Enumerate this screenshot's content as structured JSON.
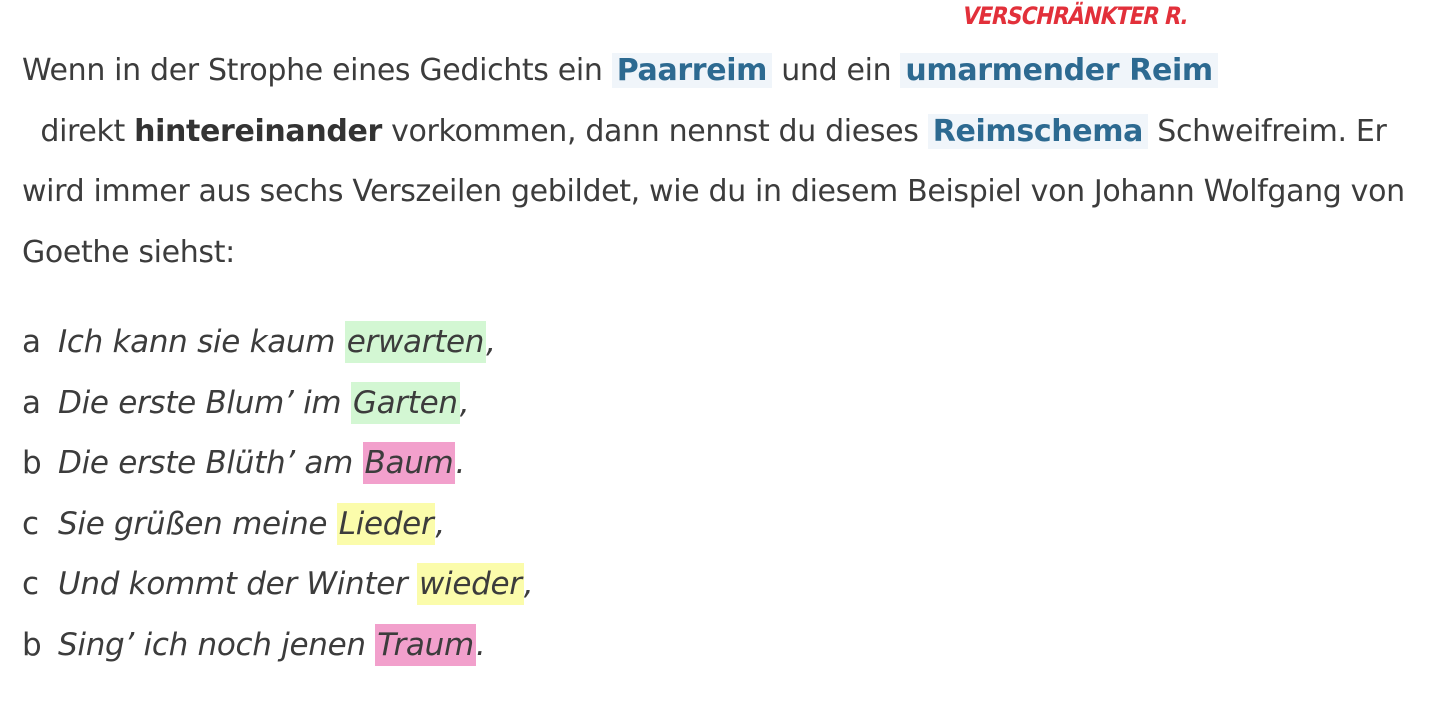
{
  "annotation": "VERSCHRÄNKTER R.",
  "intro": {
    "t1": "Wenn in der Strophe eines Gedichts ein ",
    "link1": "Paarreim",
    "t2": " und ein ",
    "link2": "umarmender Reim",
    "t3": "  direkt ",
    "bold1": "hintereinander",
    "t4": " vorkommen, dann nennst du dieses ",
    "link3": "Reimschema",
    "t5": " Schweifreim. Er wird immer aus sechs Verszeilen gebildet, wie du in diesem Beispiel von Johann Wolfgang von Goethe siehst:"
  },
  "poem": [
    {
      "letter": "a",
      "text": "Ich kann sie kaum ",
      "rhyme": "erwarten",
      "end": ",",
      "color": "#d3f7d3"
    },
    {
      "letter": "a",
      "text": "Die erste Blum’ im ",
      "rhyme": "Garten",
      "end": ",",
      "color": "#d3f7d3"
    },
    {
      "letter": "b",
      "text": "Die erste Blüth’ am ",
      "rhyme": "Baum",
      "end": ".",
      "color": "#f2a0cc"
    },
    {
      "letter": "c",
      "text": "Sie grüßen meine ",
      "rhyme": "Lieder",
      "end": ",",
      "color": "#fbfcab"
    },
    {
      "letter": "c",
      "text": "Und kommt der Winter ",
      "rhyme": "wieder",
      "end": ",",
      "color": "#fbfcab"
    },
    {
      "letter": "b",
      "text": "Sing’ ich noch jenen ",
      "rhyme": "Traum",
      "end": ".",
      "color": "#f2a0cc"
    }
  ]
}
